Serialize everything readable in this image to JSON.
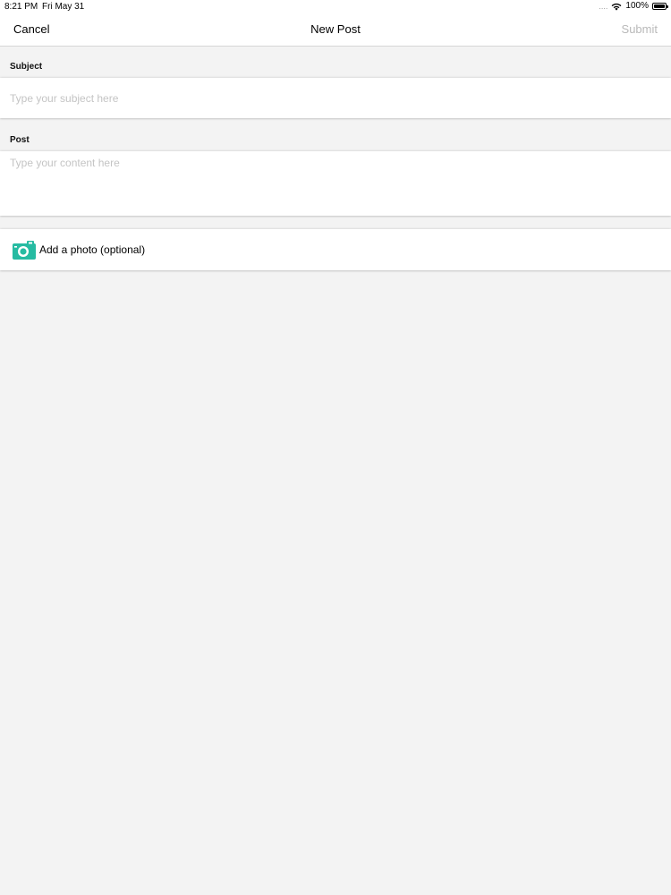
{
  "status_bar": {
    "time": "8:21 PM",
    "date": "Fri May 31",
    "signal": "....",
    "battery_percent": "100%",
    "battery_level": 1.0
  },
  "nav": {
    "cancel_label": "Cancel",
    "title": "New Post",
    "submit_label": "Submit"
  },
  "form": {
    "subject_label": "Subject",
    "subject_placeholder": "Type your subject here",
    "subject_value": "",
    "post_label": "Post",
    "post_placeholder": "Type your content here",
    "post_value": ""
  },
  "photo": {
    "label": "Add a photo (optional)",
    "icon": "camera-icon",
    "icon_color": "#26bba2"
  },
  "colors": {
    "background": "#f3f3f3",
    "disabled_text": "#b9b9b9",
    "placeholder": "#c4c4c4",
    "accent": "#26bba2"
  }
}
